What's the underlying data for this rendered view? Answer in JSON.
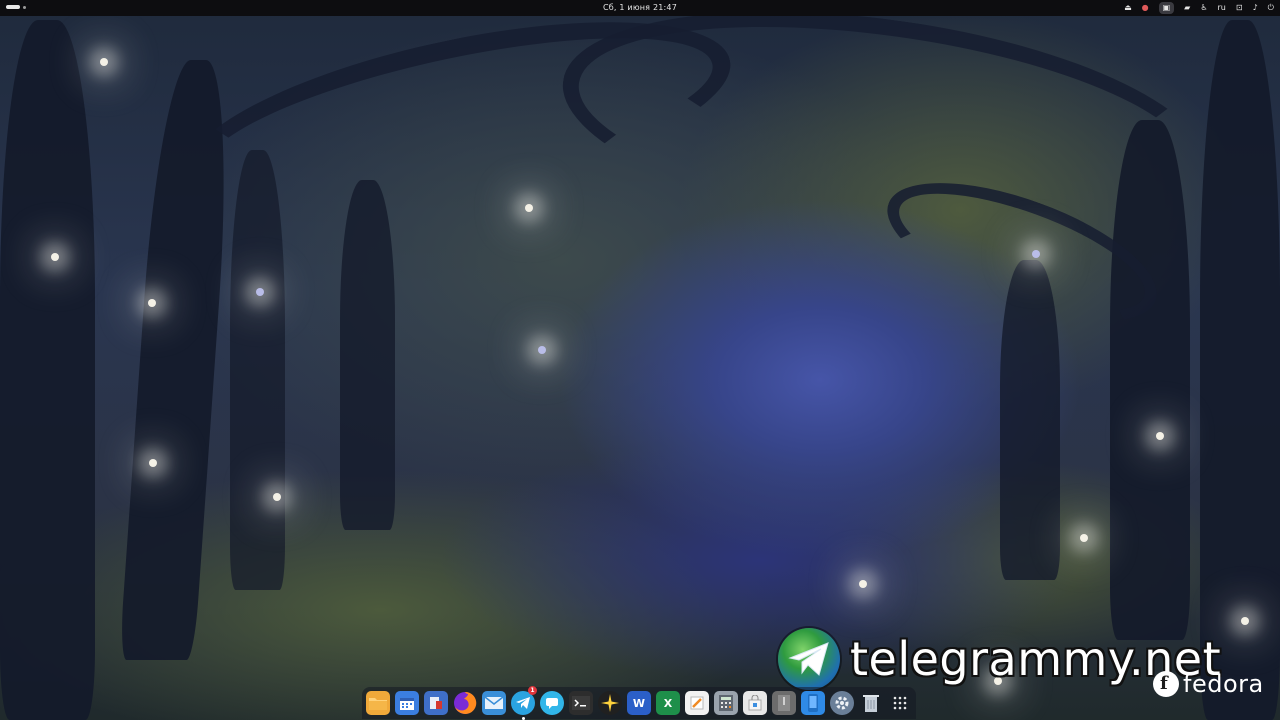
{
  "topbar": {
    "datetime": "Сб, 1 июня  21:47",
    "keyboard_layout": "ru"
  },
  "watermark": {
    "site": "telegrammy.net",
    "os_logo_text": "fedora"
  },
  "dock": {
    "apps": [
      {
        "id": "files",
        "icon": "folder-icon",
        "color": "#f0a93a"
      },
      {
        "id": "calendar",
        "icon": "calendar-icon",
        "color": "#3b7ee0"
      },
      {
        "id": "app-store",
        "icon": "store-icon",
        "color": "#3f6fc8"
      },
      {
        "id": "firefox",
        "icon": "firefox-icon",
        "color": "#ff7b1f"
      },
      {
        "id": "mail",
        "icon": "mail-icon",
        "color": "#3a8fd8"
      },
      {
        "id": "telegram",
        "icon": "telegram-icon",
        "color": "#2aa3e0",
        "badge": "1",
        "running": true
      },
      {
        "id": "chat",
        "icon": "chat-icon",
        "color": "#31b6e9"
      },
      {
        "id": "terminal",
        "icon": "terminal-icon",
        "color": "#2d2d2d"
      },
      {
        "id": "spark",
        "icon": "spark-icon",
        "color": "#202020"
      },
      {
        "id": "word",
        "icon": "word-icon",
        "color": "#2b5fc8",
        "letter": "W"
      },
      {
        "id": "excel",
        "icon": "excel-icon",
        "color": "#1e8f4a",
        "letter": "X"
      },
      {
        "id": "text-editor",
        "icon": "notepad-icon",
        "color": "#f2f2f2"
      },
      {
        "id": "calculator",
        "icon": "calculator-icon",
        "color": "#9aa3ad"
      },
      {
        "id": "software",
        "icon": "bag-icon",
        "color": "#e8e8e8"
      },
      {
        "id": "archive",
        "icon": "archive-icon",
        "color": "#6c6c6c"
      },
      {
        "id": "phone",
        "icon": "phone-icon",
        "color": "#2f8ae6"
      },
      {
        "id": "settings",
        "icon": "settings-gear-icon",
        "color": "#6a7f98"
      },
      {
        "id": "trash",
        "icon": "trash-icon",
        "color": "#9aa6b4"
      },
      {
        "id": "show-apps",
        "icon": "grid-icon",
        "color": "transparent"
      }
    ],
    "word_letter": "W",
    "excel_letter": "X",
    "telegram_badge": "1"
  }
}
